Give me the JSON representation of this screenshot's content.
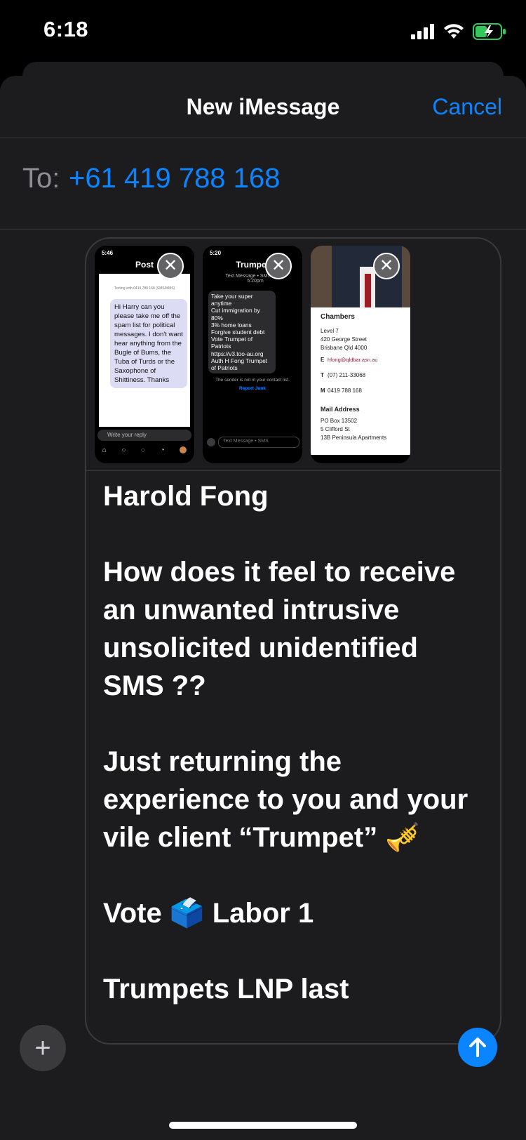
{
  "status": {
    "time": "6:18"
  },
  "header": {
    "title": "New iMessage",
    "cancel_label": "Cancel"
  },
  "recipient": {
    "label": "To:",
    "value": "+61 419 788 168"
  },
  "attachments": [
    {
      "time": "5:46",
      "title": "Post",
      "header_note": "Texting with 0419 788 168 (SMS/MMS)",
      "bubble": "Hi Harry can you please take me off the spam list for political messages. I don't want hear anything from the Bugle of Bums, the Tuba of Turds or the Saxophone of Shittiness. Thanks",
      "reply_placeholder": "Write your reply"
    },
    {
      "time": "5:20",
      "title": "Trumpet",
      "meta": "Text Message • SMS Today 5:20pm",
      "bubble": "Take your super anytime\nCut immigration by 80%\n3% home loans\nForgive student debt\nVote Trumpet of Patriots\nhttps://v3.too-au.org\nAuth H Fong Trumpet of Patriots",
      "notice": "The sender is not in your contact list.",
      "report": "Report Junk",
      "input_placeholder": "Text Message • SMS"
    },
    {
      "heading": "Chambers",
      "address": "Level 7\n420 George Street\nBrisbane Qld 4000",
      "email": "hfong@qldbar.asn.au",
      "phone": "(07) 211-33068",
      "mobile": "0419 788 168",
      "mail_heading": "Mail Address",
      "mail_address": "PO Box 13502\n5 Clifford St\n13B Peninsula Apartments"
    }
  ],
  "message": {
    "text": "Harold Fong\n\nHow does it feel to receive an unwanted intrusive unsolicited unidentified SMS ??\n\nJust returning the experience to you and your vile client “Trumpet” 🎺\n\nVote 🗳️ Labor 1\n\nTrumpets LNP last"
  },
  "colors": {
    "accent": "#0a84ff",
    "sheet": "#1c1c1e",
    "bubble_blue": "#0a84ff"
  }
}
